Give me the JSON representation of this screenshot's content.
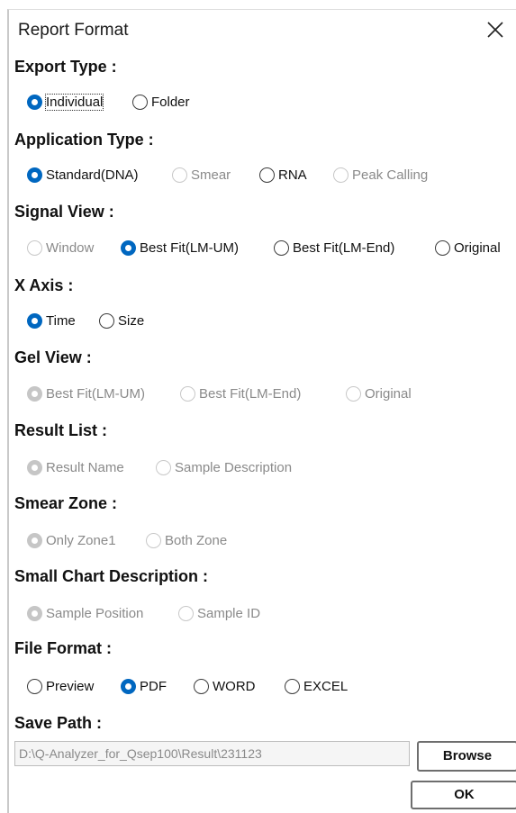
{
  "title": "Report Format",
  "accent_color": "#0067c0",
  "sections": {
    "export_type": {
      "label": "Export Type :",
      "options": [
        "Individual",
        "Folder"
      ],
      "selected": "Individual"
    },
    "application_type": {
      "label": "Application Type :",
      "options": [
        "Standard(DNA)",
        "Smear",
        "RNA",
        "Peak Calling"
      ],
      "selected": "Standard(DNA)"
    },
    "signal_view": {
      "label": "Signal View :",
      "options": [
        "Window",
        "Best Fit(LM-UM)",
        "Best Fit(LM-End)",
        "Original"
      ],
      "selected": "Best Fit(LM-UM)"
    },
    "x_axis": {
      "label": "X Axis :",
      "options": [
        "Time",
        "Size"
      ],
      "selected": "Time"
    },
    "gel_view": {
      "label": "Gel View :",
      "options": [
        "Best Fit(LM-UM)",
        "Best Fit(LM-End)",
        "Original"
      ],
      "selected": "Best Fit(LM-UM)"
    },
    "result_list": {
      "label": "Result List :",
      "options": [
        "Result Name",
        "Sample Description"
      ],
      "selected": "Result Name"
    },
    "smear_zone": {
      "label": "Smear Zone :",
      "options": [
        "Only Zone1",
        "Both Zone"
      ],
      "selected": "Only Zone1"
    },
    "small_chart_description": {
      "label": "Small Chart Description :",
      "options": [
        "Sample Position",
        "Sample ID"
      ],
      "selected": "Sample Position"
    },
    "file_format": {
      "label": "File Format :",
      "options": [
        "Preview",
        "PDF",
        "WORD",
        "EXCEL"
      ],
      "selected": "PDF"
    }
  },
  "save_path": {
    "label": "Save Path :",
    "value": "D:\\Q-Analyzer_for_Qsep100\\Result\\231123"
  },
  "buttons": {
    "browse": "Browse",
    "ok": "OK"
  }
}
